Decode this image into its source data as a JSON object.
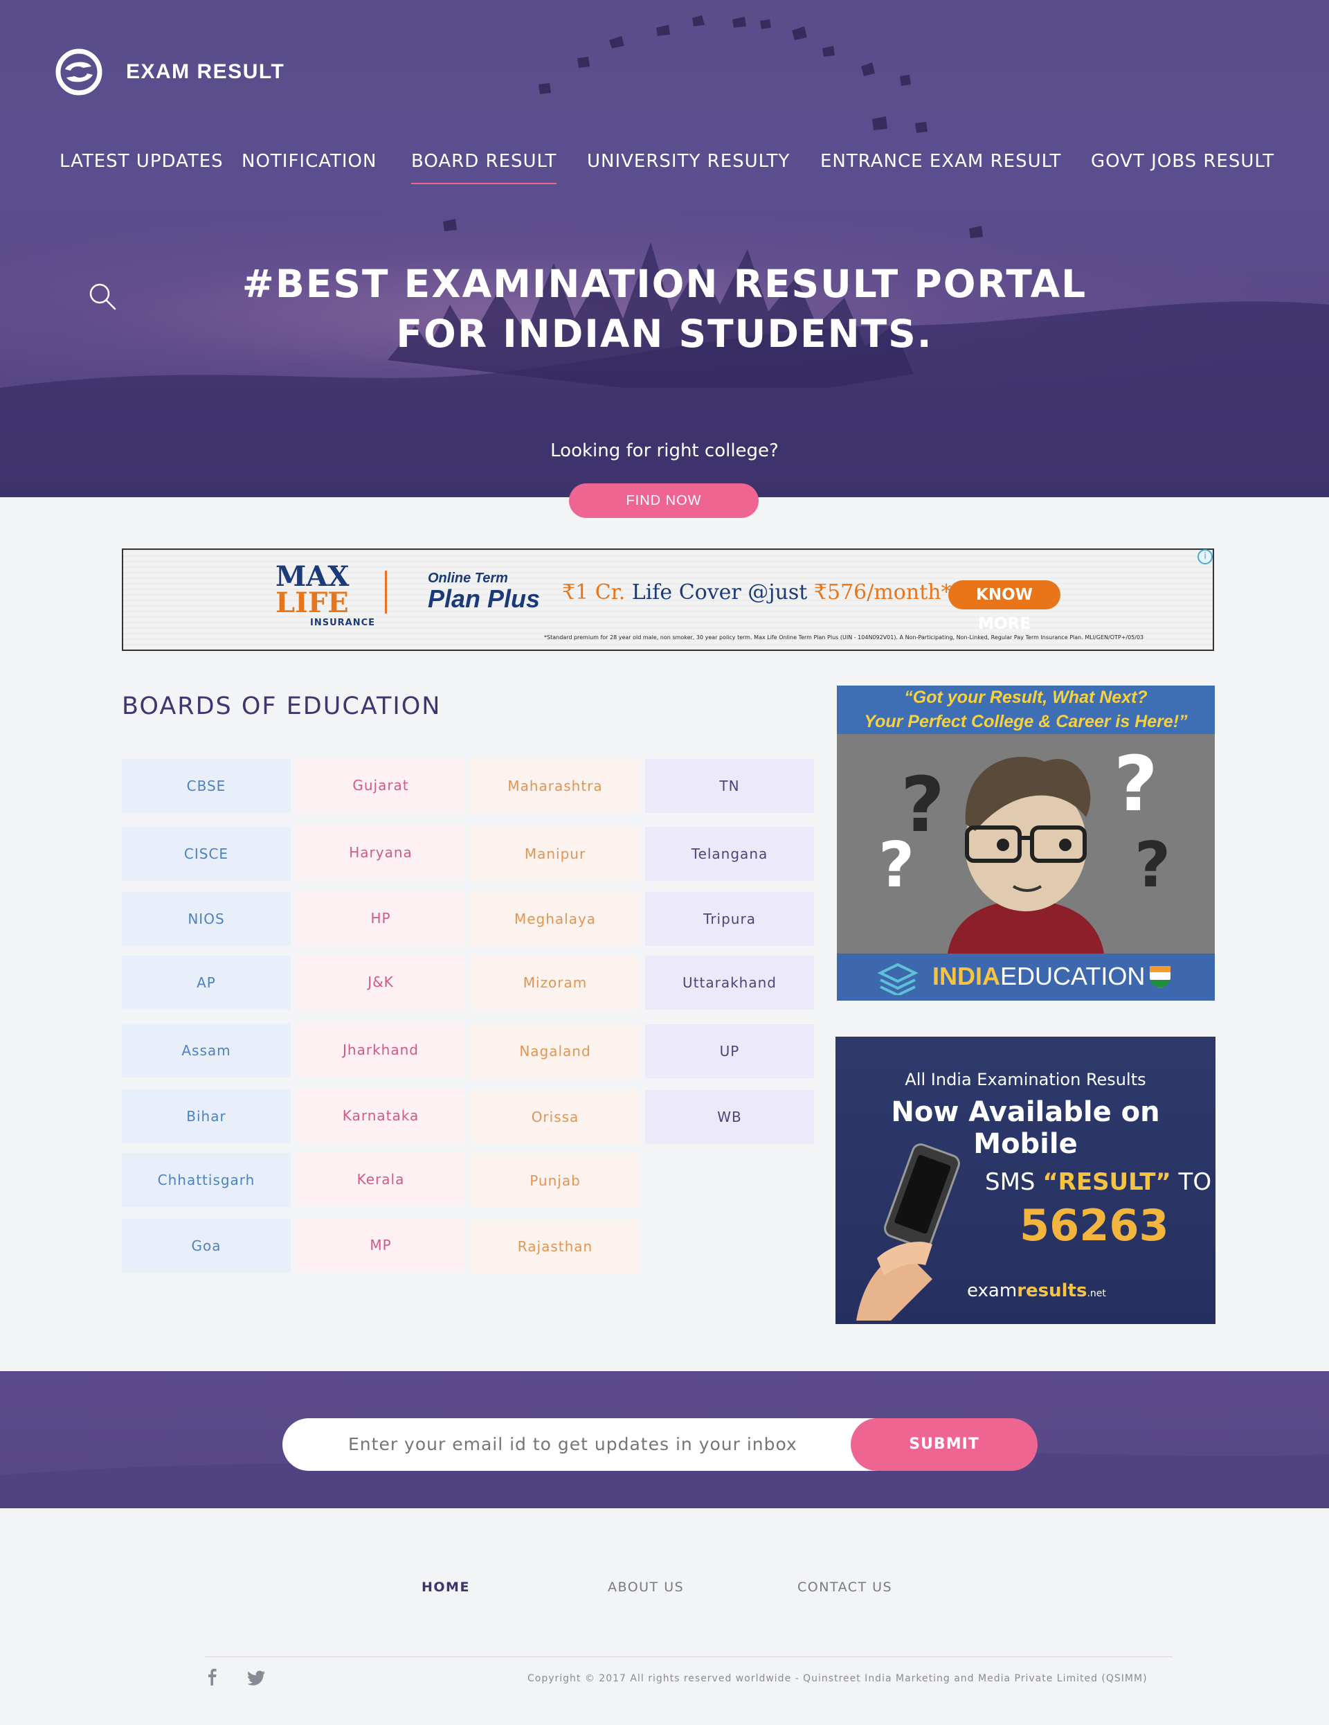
{
  "header": {
    "brand": "EXAM RESULT",
    "nav": [
      {
        "label": "LATEST UPDATES"
      },
      {
        "label": "NOTIFICATION"
      },
      {
        "label": "BOARD RESULT"
      },
      {
        "label": "UNIVERSITY RESULTY"
      },
      {
        "label": "ENTRANCE EXAM RESULT"
      },
      {
        "label": "GOVT JOBS RESULT"
      }
    ],
    "active_nav": "BOARD RESULT"
  },
  "hero": {
    "headline_line1": "#BEST EXAMINATION RESULT PORTAL",
    "headline_line2": "FOR INDIAN STUDENTS.",
    "subtext": "Looking for right college?",
    "button": "FIND NOW"
  },
  "banner_ad": {
    "brand_max": "MAX",
    "brand_life": "LIFE",
    "brand_insurance": "INSURANCE",
    "product_top": "Online Term",
    "product_bottom": "Plan Plus",
    "offer_a": "₹1 Cr.",
    "offer_b": " Life Cover @just ",
    "offer_c": "₹576/month*",
    "cta": "KNOW MORE",
    "fineprint": "*Standard premium for 28 year old male, non smoker, 30 year policy term. Max Life Online Term Plan Plus (UIN - 104N092V01). A Non-Participating, Non-Linked, Regular Pay Term Insurance Plan. MLI/GEN/OTP+/05/03"
  },
  "boards": {
    "title": "BOARDS OF EDUCATION",
    "col1": [
      "CBSE",
      "CISCE",
      "NIOS",
      "AP",
      "Assam",
      "Bihar",
      "Chhattisgarh",
      "Goa"
    ],
    "col2": [
      "Gujarat",
      "Haryana",
      "HP",
      "J&K",
      "Jharkhand",
      "Karnataka",
      "Kerala",
      "MP"
    ],
    "col3": [
      "Maharashtra",
      "Manipur",
      "Meghalaya",
      "Mizoram",
      "Nagaland",
      "Orissa",
      "Punjab",
      "Rajasthan"
    ],
    "col4": [
      "TN",
      "Telangana",
      "Tripura",
      "Uttarakhand",
      "UP",
      "WB"
    ]
  },
  "side_ad_1": {
    "line1": "“Got your Result, What Next?",
    "line2": "Your Perfect College & Career is Here!”",
    "brand_a": "INDIA",
    "brand_b": "EDUCATION"
  },
  "side_ad_2": {
    "line1": "All India Examination Results",
    "line2": "Now Available on Mobile",
    "sms_a": "SMS ",
    "sms_b": "“RESULT”",
    "sms_c": " TO",
    "number": "56263",
    "site_a": "exam",
    "site_b": "results",
    "site_c": ".net"
  },
  "newsletter": {
    "placeholder": "Enter your email id to get updates in your inbox",
    "button": "SUBMIT"
  },
  "footer": {
    "links": [
      "HOME",
      "ABOUT US",
      "CONTACT US"
    ],
    "copyright": "Copyright © 2017 All rights reserved worldwide - Quinstreet India Marketing and Media Private Limited (QSIMM)"
  },
  "colors": {
    "primary_purple": "#5a4d8a",
    "accent_pink": "#ef6592",
    "title_purple": "#40356f"
  }
}
